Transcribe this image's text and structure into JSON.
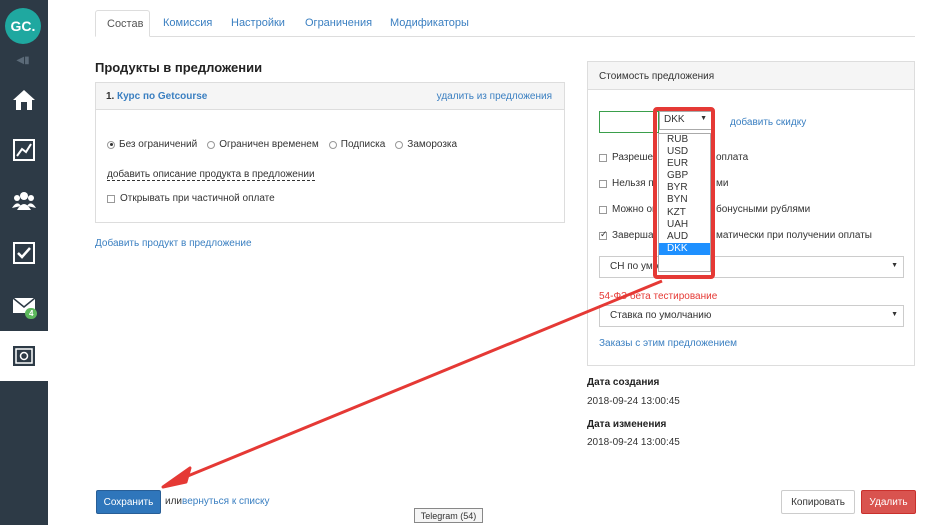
{
  "sidebar": {
    "logo": "GC.",
    "mail_badge": "4"
  },
  "tabs": [
    "Состав",
    "Комиссия",
    "Настройки",
    "Ограничения",
    "Модификаторы"
  ],
  "products": {
    "heading": "Продукты в предложении",
    "item_number": "1.",
    "item_name": "Курс по Getcourse",
    "remove_link": "удалить из предложения",
    "radio_options": [
      "Без ограничений",
      "Ограничен временем",
      "Подписка",
      "Заморозка"
    ],
    "add_description": "добавить описание продукта в предложении",
    "partial_payment": "Открывать при частичной оплате",
    "add_product": "Добавить продукт в предложение"
  },
  "price": {
    "heading": "Стоимость предложения",
    "currency_selected": "DKK",
    "add_discount": "добавить скидку",
    "checkbox_1": "Разреше",
    "checkbox_1b": "оплата",
    "checkbox_2": "Нельзя п",
    "checkbox_2b": "ми",
    "checkbox_3": "Можно оп",
    "checkbox_3b": "бонусными рублями",
    "checkbox_4": "Заверша",
    "checkbox_4b": "матически при получении оплаты",
    "tax_select": "СН по умо",
    "fz_label": "54-ФЗ бета тестирование",
    "rate_select": "Ставка по умолчанию",
    "orders_link": "Заказы с этим предложением"
  },
  "currencies": [
    "RUB",
    "USD",
    "EUR",
    "GBP",
    "BYR",
    "BYN",
    "KZT",
    "UAH",
    "AUD",
    "DKK"
  ],
  "meta": {
    "created_label": "Дата создания",
    "created_value": "2018-09-24 13:00:45",
    "modified_label": "Дата изменения",
    "modified_value": "2018-09-24 13:00:45"
  },
  "footer": {
    "save": "Сохранить",
    "or": "или",
    "back": "вернуться к списку",
    "copy": "Копировать",
    "delete": "Удалить",
    "tooltip": "Telegram (54)"
  },
  "colors": {
    "accent": "#3a7fc1",
    "highlight": "#e53935",
    "save": "#2f76bb",
    "danger": "#d9534f"
  }
}
